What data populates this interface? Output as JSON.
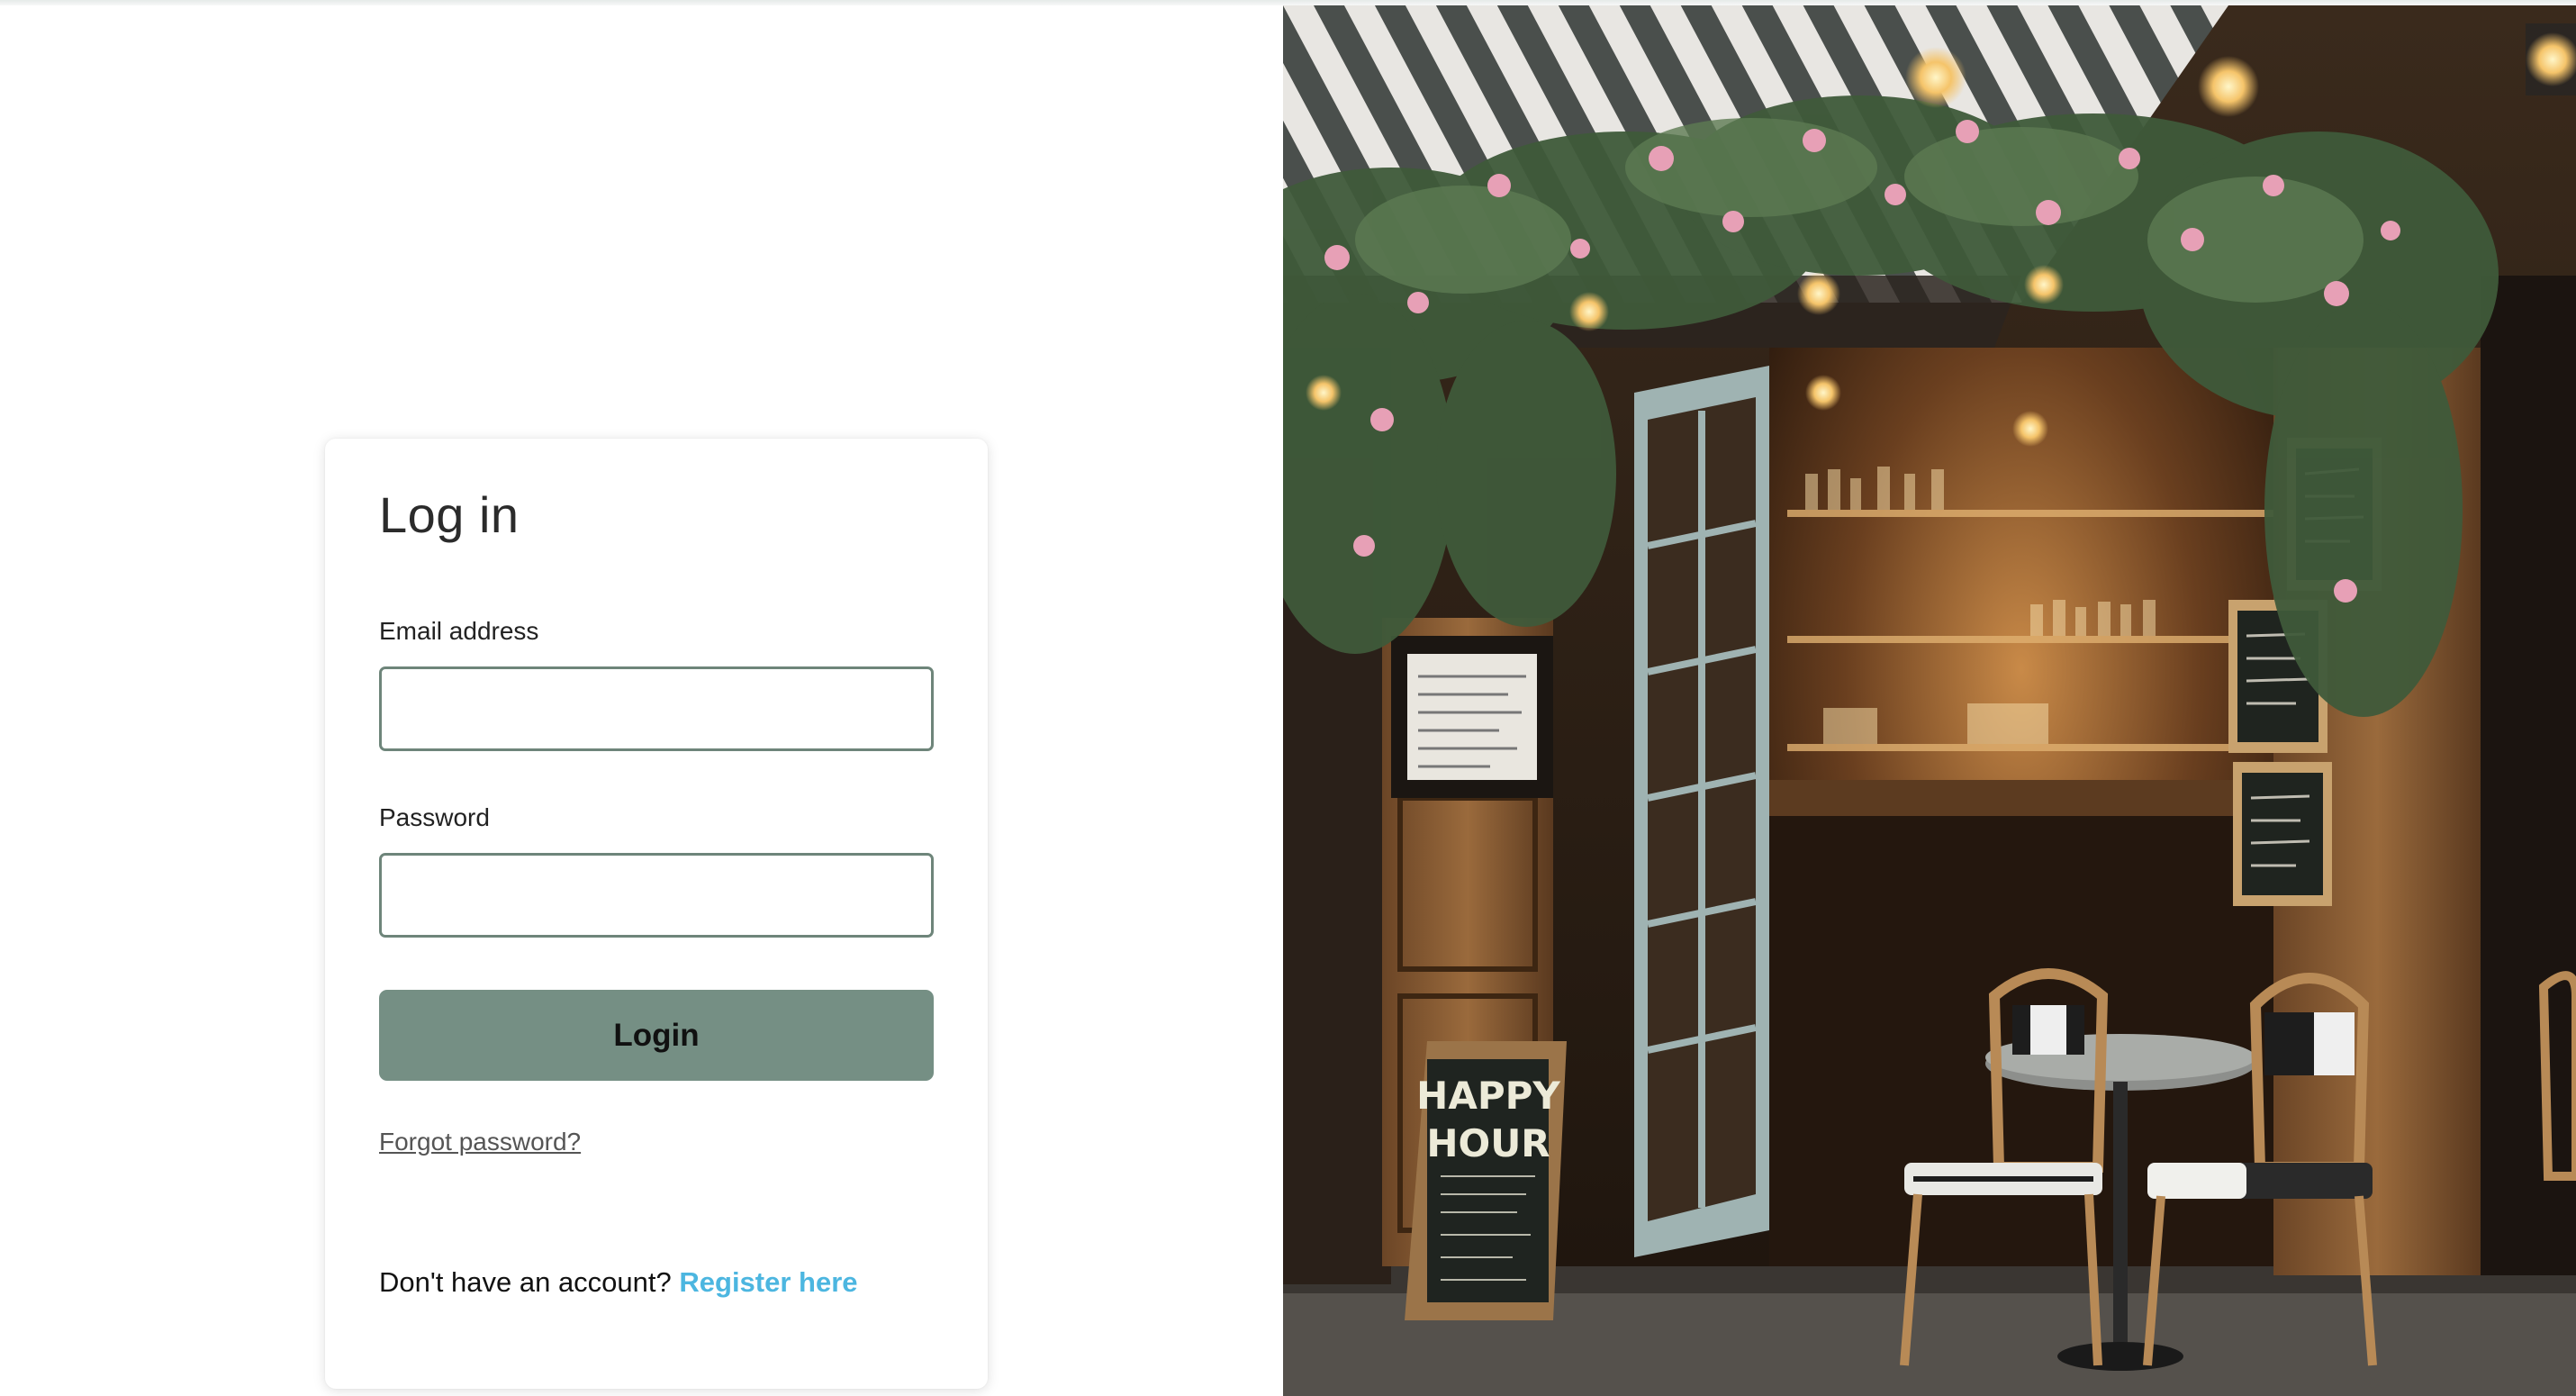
{
  "login": {
    "title": "Log in",
    "email_label": "Email address",
    "email_value": "",
    "password_label": "Password",
    "password_value": "",
    "submit_label": "Login",
    "forgot_link": "Forgot password?",
    "no_account_text": "Don't have an account? ",
    "register_link": "Register here"
  },
  "photo": {
    "subject": "cafe storefront with flower-covered striped awning, open doors, bar interior, bistro chairs and table",
    "sign_line1": "HAPPY",
    "sign_line2": "HOUR"
  },
  "colors": {
    "accent": "#758f84",
    "input_border": "#6e857a",
    "link": "#4cb6e0"
  }
}
